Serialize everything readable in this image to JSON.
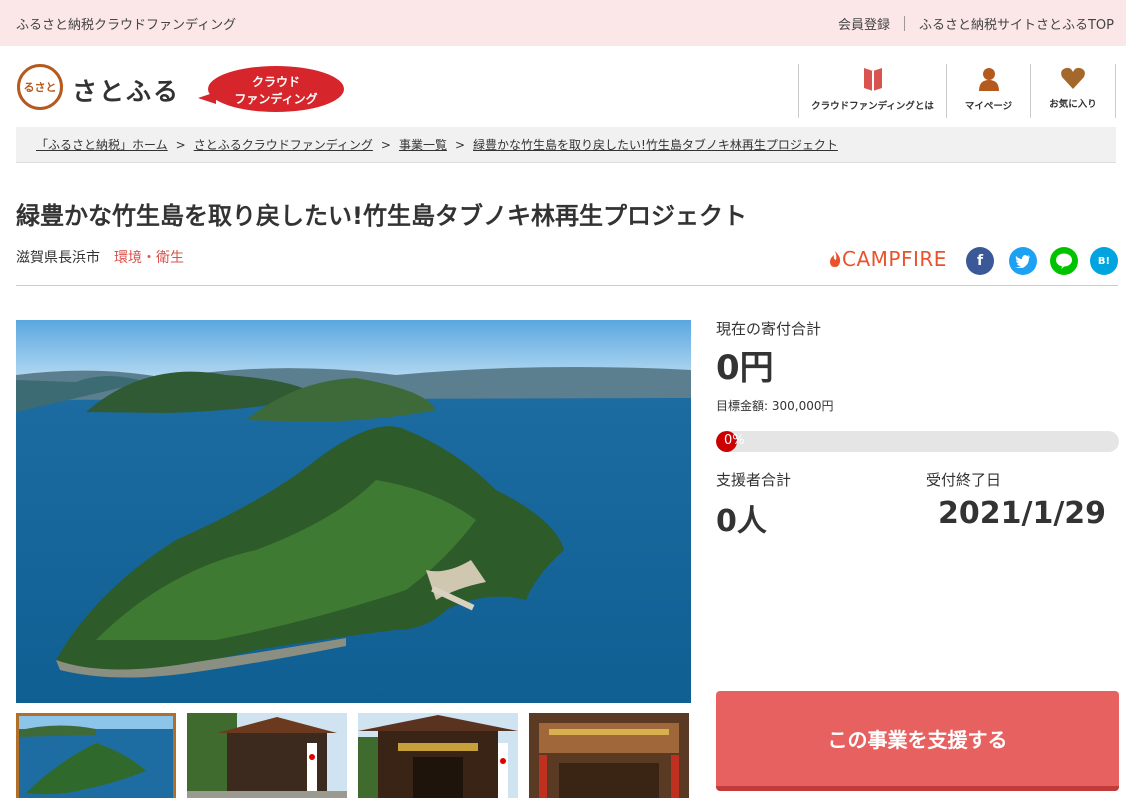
{
  "topbar": {
    "site_name": "ふるさと納税クラウドファンディング",
    "register_label": "会員登録",
    "top_link_label": "ふるさと納税サイトさとふるTOP"
  },
  "header": {
    "logo_mark_text": "るさと",
    "logo_text": "さとふる",
    "cf_badge_line1": "クラウド",
    "cf_badge_line2": "ファンディング",
    "nav": {
      "about_label": "クラウドファンディングとは",
      "mypage_label": "マイページ",
      "favorites_label": "お気に入り"
    }
  },
  "breadcrumb": [
    "「ふるさと納税」ホーム",
    "さとふるクラウドファンディング",
    "事業一覧",
    "緑豊かな竹生島を取り戻したい!竹生島タブノキ林再生プロジェクト"
  ],
  "breadcrumb_sep": ">",
  "project": {
    "title": "緑豊かな竹生島を取り戻したい!竹生島タブノキ林再生プロジェクト",
    "location": "滋賀県長浜市",
    "category": "環境・衛生",
    "partner": "CAMPFIRE"
  },
  "share": {
    "facebook": "f",
    "twitter": "t",
    "line": "LINE",
    "hatena": "B!"
  },
  "stats": {
    "current_label": "現在の寄付合計",
    "current_value": "0円",
    "goal_text": "目標金額: 300,000円",
    "progress_percent_text": "0%",
    "progress_fraction": 0,
    "supporters_label": "支援者合計",
    "supporters_value": "0人",
    "deadline_label": "受付終了日",
    "deadline_value": "2021/1/29"
  },
  "cta": {
    "support_label": "この事業を支援する"
  },
  "colors": {
    "accent": "#e86161",
    "topbar_bg": "#fbe7e7",
    "brand": "#b45a1f",
    "category": "#d9534f"
  }
}
